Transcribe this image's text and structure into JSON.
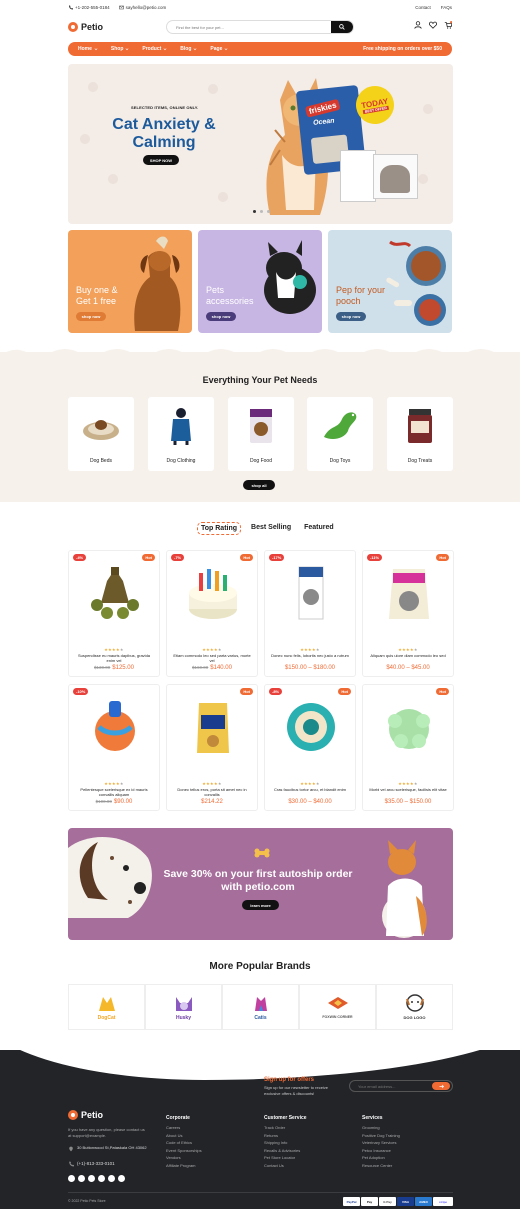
{
  "topbar": {
    "phone": "+1-202-555-0184",
    "email": "sayhello@petio.com",
    "contact": "Contact",
    "faqs": "FAQs"
  },
  "header": {
    "logo": "Petio",
    "search_placeholder": "Find the best for your pet..."
  },
  "nav": {
    "items": [
      "Home",
      "Shop",
      "Product",
      "Blog",
      "Page"
    ],
    "shipping": "Free shipping on orders over $50"
  },
  "hero": {
    "kicker": "SELECTED ITEMS, ONLINE ONLY.",
    "title": "Cat Anxiety & Calming",
    "button": "SHOP NOW",
    "badge_line1": "TODAY",
    "badge_line2": "BEST OFFER",
    "bag_brand": "friskies",
    "bag_sub": "Ocean"
  },
  "promos": [
    {
      "title": "Buy one & Get 1 free",
      "button": "shop now",
      "bg": "#f2a05a",
      "btn": "#e07b35"
    },
    {
      "title": "Pets accessories",
      "button": "shop now",
      "bg": "#c7b6e3",
      "btn": "#4a3b7a"
    },
    {
      "title": "Pep for your pooch",
      "button": "shop now",
      "bg": "#cfe0ea",
      "btn": "#3b5f86"
    }
  ],
  "categories": {
    "title": "Everything Your Pet Needs",
    "items": [
      "Dog Beds",
      "Dog Clothing",
      "Dog Food",
      "Dog Toys",
      "Dog Treats"
    ],
    "button": "shop all"
  },
  "tabs": [
    "Top Rating",
    "Best Selling",
    "Featured"
  ],
  "products": [
    {
      "badge": "-4%",
      "badge_color": "#e8403a",
      "hot": "Hot",
      "name": "Suspendisse eu mauris dapibus, gravida enim vel",
      "old": "$130.00",
      "price": "$125.00"
    },
    {
      "badge": "-7%",
      "badge_color": "#e8403a",
      "hot": "Hot",
      "name": "Etiam commodo leo sed parta varius, morte vel",
      "old": "$160.00",
      "price": "$140.00"
    },
    {
      "badge": "-17%",
      "badge_color": "#e8403a",
      "hot": "",
      "name": "Donec nunc felis, lobortis nec justo a rutrum",
      "old": "",
      "price": "$150.00 – $180.00"
    },
    {
      "badge": "-11%",
      "badge_color": "#e8403a",
      "hot": "Hot",
      "name": "Aliquam quis ulore diam commodo leo sed",
      "old": "",
      "price": "$40.00 – $45.00"
    },
    {
      "badge": "-10%",
      "badge_color": "#e8403a",
      "hot": "",
      "name": "Pellentesque scelerisque ex id mauris convallis aliquam",
      "old": "$100.00",
      "price": "$90.00"
    },
    {
      "badge": "",
      "badge_color": "#e8403a",
      "hot": "Hot",
      "name": "Donec tellus eros, porta sit amet nec in convallis",
      "old": "",
      "price": "$214.22"
    },
    {
      "badge": "-8%",
      "badge_color": "#e8403a",
      "hot": "Hot",
      "name": "Cras faucibus tortor arcu, et blandit enim",
      "old": "",
      "price": "$30.00 – $40.00"
    },
    {
      "badge": "",
      "badge_color": "#e8403a",
      "hot": "Hot",
      "name": "Morbi vel arcu scelerisque, facilisis elit vitae",
      "old": "",
      "price": "$35.00 – $150.00"
    }
  ],
  "autoship": {
    "title": "Save 30% on your first autoship order with petio.com",
    "button": "learn more"
  },
  "brands": {
    "title": "More Popular Brands",
    "items": [
      "DogCat",
      "Husky",
      "Catis",
      "FOXWIN CORNER",
      "DOG LOGO"
    ]
  },
  "newsletter": {
    "title": "Sign up for offers",
    "text": "Sign up for our newsletter to receive exclusive offers & discounts!",
    "placeholder": "Your email address..."
  },
  "footer": {
    "logo": "Petio",
    "about": "If you have any question, please contact us at support@example.",
    "address": "30 Buttonwood St,Pataskala OH 43062",
    "phone": "(+1)-813-333-0101",
    "cols": [
      {
        "title": "Corporate",
        "links": [
          "Careers",
          "About Us",
          "Code of Ethics",
          "Event Sponsorships",
          "Vendors",
          "Affiliate Program"
        ]
      },
      {
        "title": "Customer Service",
        "links": [
          "Track Order",
          "Returns",
          "Shipping Info",
          "Recalls & Advisories",
          "Pet Store Locator",
          "Contact Us"
        ]
      },
      {
        "title": "Services",
        "links": [
          "Grooming",
          "Positive Dog Training",
          "Veterinary Services",
          "Petco Insurance",
          "Pet Adoption",
          "Resource Center"
        ]
      }
    ],
    "copyright": "© 2022 Petio Pets Store",
    "payments": [
      "PayPal",
      "Pay",
      "G Pay",
      "VISA",
      "AMEX",
      "stripe",
      "Clearpay"
    ]
  }
}
